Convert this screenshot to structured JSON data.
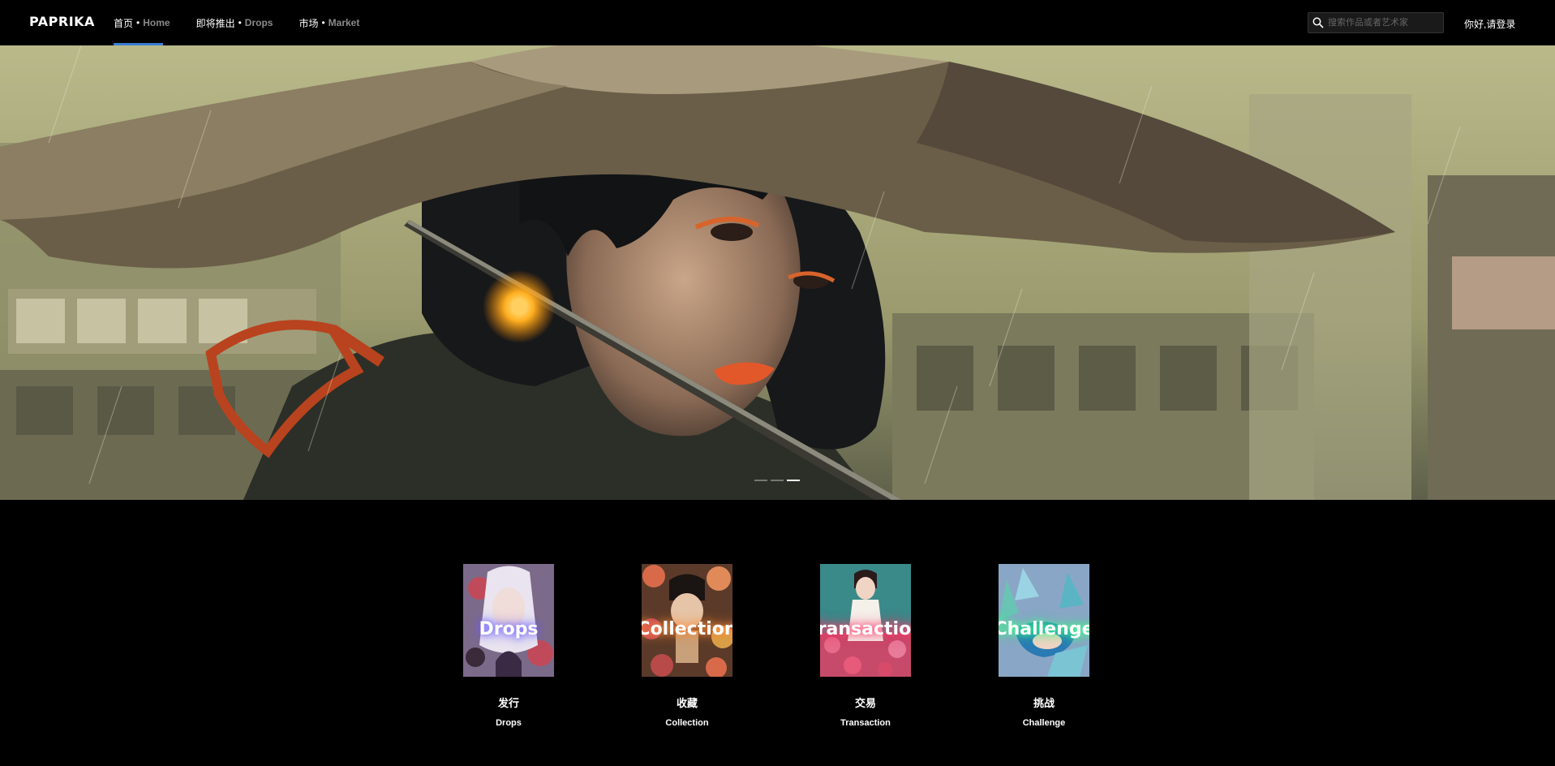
{
  "header": {
    "logo": "PAPRIKA",
    "nav": [
      {
        "zh": "首页",
        "sep": "•",
        "en": "Home"
      },
      {
        "zh": "即将推出",
        "sep": "•",
        "en": "Drops"
      },
      {
        "zh": "市场",
        "sep": "•",
        "en": "Market"
      }
    ],
    "active_nav": "Home",
    "search_placeholder": "搜索作品或者艺术家",
    "search_icon": "search-icon",
    "login": "你好,请登录"
  },
  "hero": {
    "slides_count": 3,
    "active_slide": 3
  },
  "categories": [
    {
      "overlay": "Drops",
      "zh": "发行",
      "en": "Drops",
      "glow": "#6b5cff"
    },
    {
      "overlay": "Collection",
      "zh": "收藏",
      "en": "Collection",
      "glow": "#ff8a3a"
    },
    {
      "overlay": "Transaction",
      "zh": "交易",
      "en": "Transaction",
      "glow": "#ff3a6b"
    },
    {
      "overlay": "Challenge",
      "zh": "挑战",
      "en": "Challenge",
      "glow": "#3aff8a"
    }
  ],
  "colors": {
    "background": "#000000",
    "accent": "#3a7fd5",
    "nav_en": "#8a8a8a"
  }
}
